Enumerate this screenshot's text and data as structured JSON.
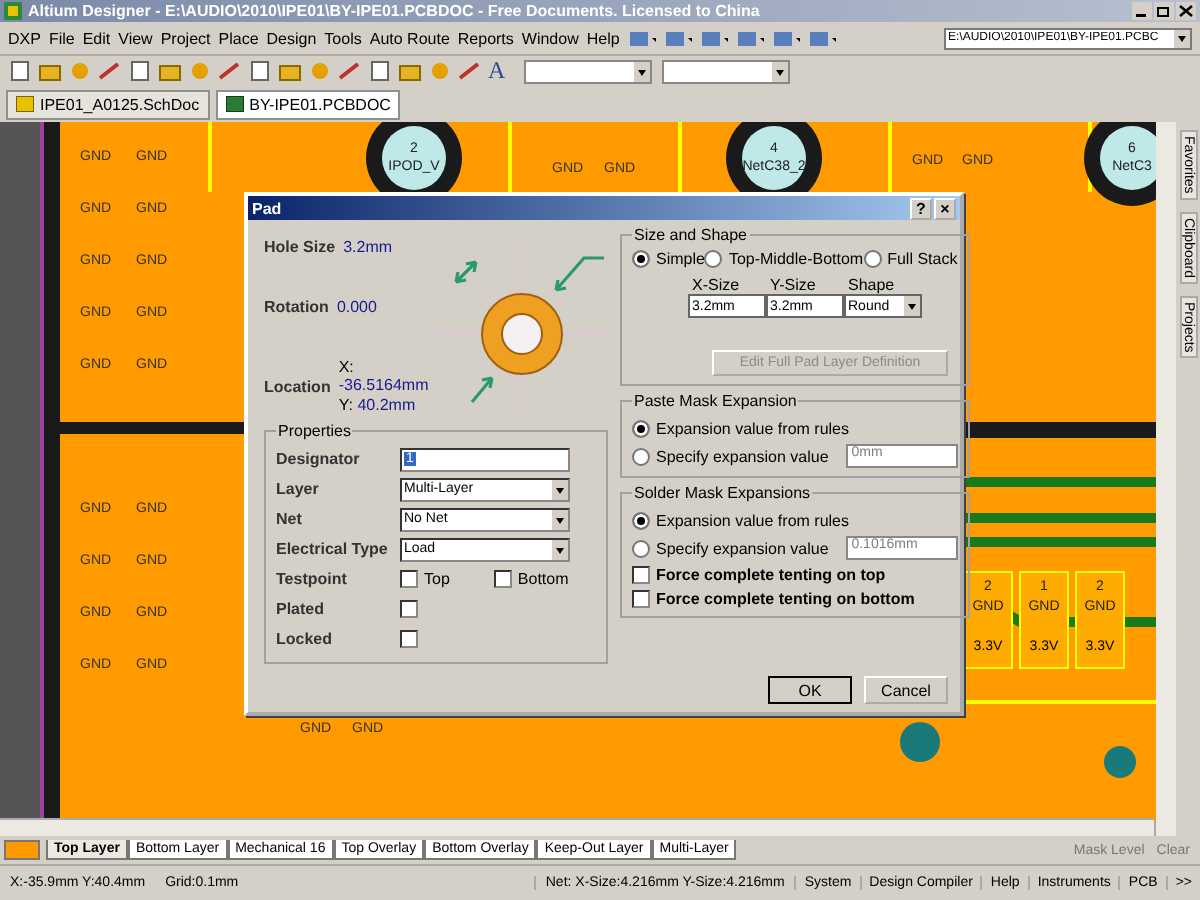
{
  "window": {
    "title": "Altium Designer - E:\\AUDIO\\2010\\IPE01\\BY-IPE01.PCBDOC - Free Documents. Licensed to China"
  },
  "menu": [
    "DXP",
    "File",
    "Edit",
    "View",
    "Project",
    "Place",
    "Design",
    "Tools",
    "Auto Route",
    "Reports",
    "Window",
    "Help"
  ],
  "path_field": {
    "value": "E:\\AUDIO\\2010\\IPE01\\BY-IPE01.PCBC"
  },
  "toolbar": {
    "text_tool": "A"
  },
  "document_tabs": [
    {
      "label": "IPE01_A0125.SchDoc",
      "kind": "schematic",
      "selected": false
    },
    {
      "label": "BY-IPE01.PCBDOC",
      "kind": "pcb",
      "selected": true
    }
  ],
  "side_panel_tabs": [
    "Favorites",
    "Clipboard",
    "Projects"
  ],
  "canvas": {
    "gnd_labels": [
      "GND",
      "GND",
      "GND",
      "GND",
      "GND",
      "GND",
      "GND",
      "GND",
      "GND",
      "GND",
      "GND",
      "GND",
      "GND",
      "GND",
      "GND",
      "GND",
      "GND",
      "GND",
      "GND",
      "GND",
      "GND",
      "GND",
      "GND",
      "GND"
    ],
    "pads": [
      {
        "number": "2",
        "net": "IPOD_V"
      },
      {
        "number": "4",
        "net": "NetC38_2"
      },
      {
        "number": "6",
        "net": "NetC3"
      }
    ],
    "small_pads": [
      {
        "number": "2",
        "net": "GND",
        "label": "3.3V"
      },
      {
        "number": "1",
        "net": "GND",
        "label": "3.3V"
      },
      {
        "number": "2",
        "net": "GND",
        "label": "3.3V"
      }
    ]
  },
  "dialog": {
    "title": "Pad",
    "help": "?",
    "close": "×",
    "hole_size": {
      "label": "Hole Size",
      "value": "3.2mm"
    },
    "rotation": {
      "label": "Rotation",
      "value": "0.000"
    },
    "location": {
      "label": "Location",
      "x_label": "X:",
      "x": "-36.5164mm",
      "y_label": "Y:",
      "y": "40.2mm"
    },
    "size_and_shape": {
      "title": "Size and Shape",
      "modes": [
        {
          "label": "Simple",
          "selected": true
        },
        {
          "label": "Top-Middle-Bottom",
          "selected": false
        },
        {
          "label": "Full Stack",
          "selected": false
        }
      ],
      "columns": [
        "X-Size",
        "Y-Size",
        "Shape"
      ],
      "values": [
        "3.2mm",
        "3.2mm",
        "Round"
      ],
      "edit_button": {
        "label": "Edit Full Pad Layer Definition",
        "disabled": true
      }
    },
    "properties": {
      "title": "Properties",
      "fields": [
        {
          "label": "Designator",
          "kind": "text",
          "value": "1"
        },
        {
          "label": "Layer",
          "kind": "select",
          "value": "Multi-Layer"
        },
        {
          "label": "Net",
          "kind": "select",
          "value": "No Net"
        },
        {
          "label": "Electrical Type",
          "kind": "select",
          "value": "Load"
        }
      ],
      "testpoint": {
        "label": "Testpoint",
        "options": [
          {
            "label": "Top",
            "checked": false
          },
          {
            "label": "Bottom",
            "checked": false
          }
        ]
      },
      "checks": [
        {
          "label": "Plated",
          "checked": false
        },
        {
          "label": "Locked",
          "checked": false
        }
      ]
    },
    "paste_mask": {
      "title": "Paste Mask Expansion",
      "options": [
        {
          "label": "Expansion value from rules",
          "selected": true
        },
        {
          "label": "Specify expansion value",
          "selected": false
        }
      ],
      "value": "0mm",
      "disabled": true
    },
    "solder_mask": {
      "title": "Solder Mask Expansions",
      "options": [
        {
          "label": "Expansion value from rules",
          "selected": true
        },
        {
          "label": "Specify expansion value",
          "selected": false
        }
      ],
      "value": "0.1016mm",
      "disabled": true,
      "checks": [
        {
          "label": "Force complete tenting on top",
          "checked": false
        },
        {
          "label": "Force complete tenting on bottom",
          "checked": false
        }
      ]
    },
    "buttons": [
      "OK",
      "Cancel"
    ]
  },
  "layer_tabs": {
    "tabs": [
      {
        "label": "Top Layer",
        "selected": true
      },
      {
        "label": "Bottom Layer",
        "selected": false
      },
      {
        "label": "Mechanical 16",
        "selected": false
      },
      {
        "label": "Top Overlay",
        "selected": false
      },
      {
        "label": "Bottom Overlay",
        "selected": false
      },
      {
        "label": "Keep-Out Layer",
        "selected": false
      },
      {
        "label": "Multi-Layer",
        "selected": false
      }
    ],
    "buttons": [
      "Mask Level",
      "Clear"
    ]
  },
  "status_bar": {
    "position": "X:-35.9mm Y:40.4mm",
    "grid": "Grid:0.1mm",
    "net": "Net: X-Size:4.216mm Y-Size:4.216mm",
    "panels": [
      "System",
      "Design Compiler",
      "Help",
      "Instruments",
      "PCB"
    ],
    "more": ">>"
  }
}
